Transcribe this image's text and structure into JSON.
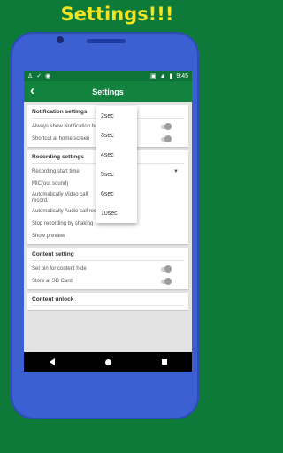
{
  "promo_title": "Settings!!!",
  "status": {
    "time": "9:45",
    "left_icons": [
      "person-icon",
      "check-icon",
      "spotify-icon"
    ],
    "right_icons": [
      "sim-icon",
      "signal-icon",
      "battery-icon"
    ]
  },
  "appbar": {
    "title": "Settings",
    "back": "‹"
  },
  "notification_settings": {
    "header": "Notification settings",
    "items": [
      "Always show Notification bar",
      "Shortcut at home screen"
    ]
  },
  "recording_settings": {
    "header": "Recording settings",
    "items": [
      "Recording start time",
      "MIC(out sound)",
      "Automatically Video call record.",
      "Automatically Audio call record",
      "Stop recording by shaking",
      "Show preview"
    ]
  },
  "content_setting": {
    "header": "Content setting",
    "items": [
      "Set pin for content hide",
      "Store at SD Card"
    ]
  },
  "content_unlock": {
    "header": "Content unlock"
  },
  "popup": {
    "options": [
      "2sec",
      "3sec",
      "4sec",
      "5sec",
      "6sec",
      "10sec"
    ]
  },
  "colors": {
    "background": "#0d7a3a",
    "appbar": "#11833f",
    "phone": "#3c5fd2",
    "title": "#f2e422"
  }
}
